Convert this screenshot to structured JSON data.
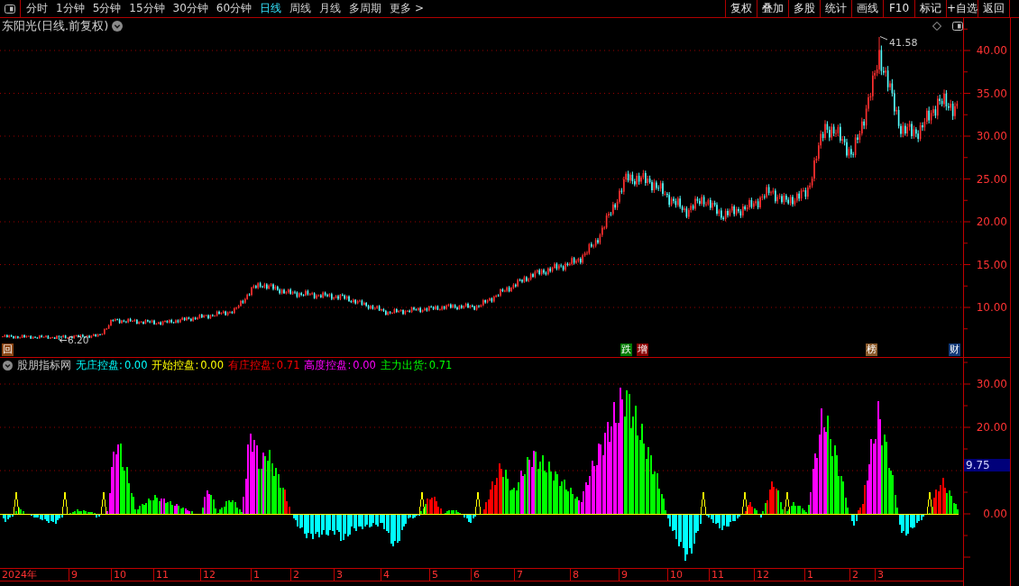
{
  "toolbar": {
    "periods": [
      {
        "label": "分时",
        "selected": false
      },
      {
        "label": "1分钟",
        "selected": false
      },
      {
        "label": "5分钟",
        "selected": false
      },
      {
        "label": "15分钟",
        "selected": false
      },
      {
        "label": "30分钟",
        "selected": false
      },
      {
        "label": "60分钟",
        "selected": false
      },
      {
        "label": "日线",
        "selected": true
      },
      {
        "label": "周线",
        "selected": false
      },
      {
        "label": "月线",
        "selected": false
      },
      {
        "label": "多周期",
        "selected": false
      }
    ],
    "more": "更多 >",
    "actions": [
      "复权",
      "叠加",
      "多股",
      "统计",
      "画线",
      "F10",
      "标记",
      "+自选",
      "返回"
    ]
  },
  "price_chart": {
    "title": "东阳光(日线.前复权)",
    "high_label": "41.58",
    "low_label": "6.20",
    "axis_labels": [
      "40.00",
      "35.00",
      "30.00",
      "25.00",
      "20.00",
      "15.00",
      "10.00"
    ],
    "markers": [
      {
        "label": "回",
        "color": "#8b4513"
      },
      {
        "label": "跌",
        "color": "#007a00"
      },
      {
        "label": "增",
        "color": "#8b0000"
      },
      {
        "label": "榜",
        "color": "#8b5a2b"
      },
      {
        "label": "财",
        "color": "#123a78"
      }
    ]
  },
  "indicator": {
    "name": "股朋指标网",
    "legend": [
      {
        "label": "无庄控盘:",
        "value": "0.00",
        "color": "#00ffff"
      },
      {
        "label": "开始控盘:",
        "value": "0.00",
        "color": "#ffff00"
      },
      {
        "label": "有庄控盘:",
        "value": "0.71",
        "color": "#ff0000"
      },
      {
        "label": "高度控盘:",
        "value": "0.00",
        "color": "#ff00ff"
      },
      {
        "label": "主力出货:",
        "value": "0.71",
        "color": "#00ff00"
      }
    ],
    "axis_labels": [
      "30.00",
      "20.00",
      "0.00"
    ],
    "cursor_value": "9.75"
  },
  "time_axis": [
    "2024年",
    "9",
    "10",
    "11",
    "12",
    "1",
    "2",
    "3",
    "4",
    "5",
    "6",
    "7",
    "8",
    "9",
    "10",
    "11",
    "12",
    "1",
    "2",
    "3"
  ]
}
